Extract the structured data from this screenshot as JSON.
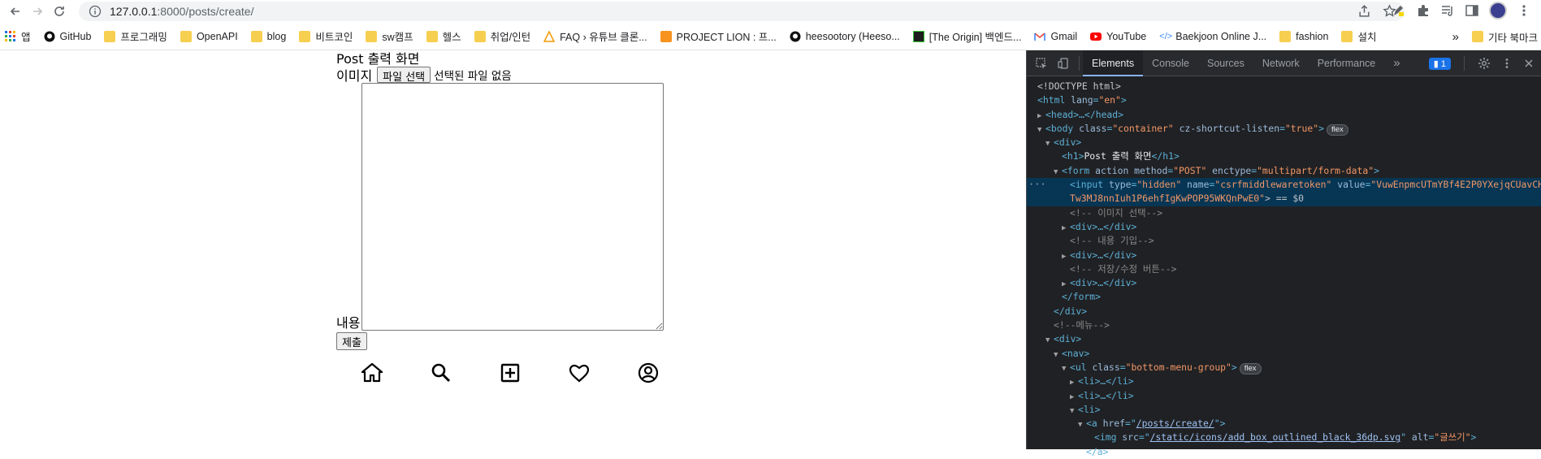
{
  "browser": {
    "url_host": "127.0.0.1",
    "url_path": ":8000/posts/create/",
    "bookmarks": [
      {
        "label": "앱",
        "icon": "apps-grid-icon"
      },
      {
        "label": "GitHub",
        "icon": "github-icon"
      },
      {
        "label": "프로그래밍",
        "icon": "folder-icon"
      },
      {
        "label": "OpenAPI",
        "icon": "folder-icon"
      },
      {
        "label": "blog",
        "icon": "folder-icon"
      },
      {
        "label": "비트코인",
        "icon": "folder-icon"
      },
      {
        "label": "sw캠프",
        "icon": "folder-icon"
      },
      {
        "label": "헬스",
        "icon": "folder-icon"
      },
      {
        "label": "취업/인턴",
        "icon": "folder-icon"
      },
      {
        "label": "FAQ › 유튜브 클론...",
        "icon": "warning-icon"
      },
      {
        "label": "PROJECT LION : 프...",
        "icon": "orange-square-icon"
      },
      {
        "label": "heesootory (Heeso...",
        "icon": "github-icon"
      },
      {
        "label": "[The Origin] 백엔드...",
        "icon": "origin-icon"
      },
      {
        "label": "Gmail",
        "icon": "gmail-icon"
      },
      {
        "label": "YouTube",
        "icon": "youtube-icon"
      },
      {
        "label": "Baekjoon Online J...",
        "icon": "code-icon"
      },
      {
        "label": "fashion",
        "icon": "folder-icon"
      },
      {
        "label": "설치",
        "icon": "folder-icon"
      }
    ],
    "more_bookmarks_label": "»",
    "other_bookmarks_label": "기타 북마크"
  },
  "page": {
    "title": "Post 출력 화면",
    "image_label": "이미지",
    "file_button": "파일 선택",
    "file_status": "선택된 파일 없음",
    "content_label": "내용",
    "submit_button": "제출",
    "menu": [
      {
        "icon": "home-icon"
      },
      {
        "icon": "search-icon"
      },
      {
        "icon": "add-box-icon"
      },
      {
        "icon": "heart-icon"
      },
      {
        "icon": "account-circle-icon"
      }
    ]
  },
  "devtools": {
    "tabs": [
      "Elements",
      "Console",
      "Sources",
      "Network",
      "Performance"
    ],
    "active_tab": "Elements",
    "more_tabs": "»",
    "issues_count": "1",
    "lines": {
      "l1": "<!DOCTYPE html>",
      "l2_tag": "<html ",
      "l2_attr": "lang",
      "l2_val": "\"en\"",
      "l3": "<head>…</head>",
      "l4_tag": "<body ",
      "l4_attr1": "class",
      "l4_val1": "\"container\"",
      "l4_attr2": " cz-shortcut-listen",
      "l4_val2": "\"true\"",
      "l4_badge": "flex",
      "l5": "<div>",
      "l6_open": "<h1>",
      "l6_text": "Post 출력 화면",
      "l6_close": "</h1>",
      "l7_tag": "<form ",
      "l7_attr1": "action method",
      "l7_val1": "\"POST\"",
      "l7_attr2": " enctype",
      "l7_val2": "\"multipart/form-data\"",
      "l8_tag": "<input ",
      "l8_attr1": "type",
      "l8_val1": "\"hidden\"",
      "l8_attr2": " name",
      "l8_val2": "\"csrfmiddlewaretoken\"",
      "l8_attr3": " value",
      "l8_val3a": "\"VuwEnpmcUTmYBf4E2P0YXejqCUavCH",
      "l9_val3b": "Tw3MJ8nnIuh1P6ehfIgKwPOP95WKQnPwE0\"",
      "l9_suffix": "> == $0",
      "l10": "<!-- 이미지 선택-->",
      "l11": "<div>…</div>",
      "l12": "<!-- 내용 기입-->",
      "l13": "<div>…</div>",
      "l14": "<!-- 저장/수정 버튼-->",
      "l15": "<div>…</div>",
      "l16": "</form>",
      "l17": "</div>",
      "l18": "<!--메뉴-->",
      "l19": "<div>",
      "l20": "<nav>",
      "l21_tag": "<ul ",
      "l21_attr": "class",
      "l21_val": "\"bottom-menu-group\"",
      "l21_badge": "flex",
      "l22": "<li>…</li>",
      "l23": "<li>…</li>",
      "l24": "<li>",
      "l25_tag": "<a ",
      "l25_attr": "href",
      "l25_link": "/posts/create/",
      "l26_tag": "<img ",
      "l26_attr1": "src",
      "l26_link": "/static/icons/add_box_outlined_black_36dp.svg",
      "l26_attr2": " alt",
      "l26_val2": "\"글쓰기\"",
      "l27": "</a>"
    }
  }
}
